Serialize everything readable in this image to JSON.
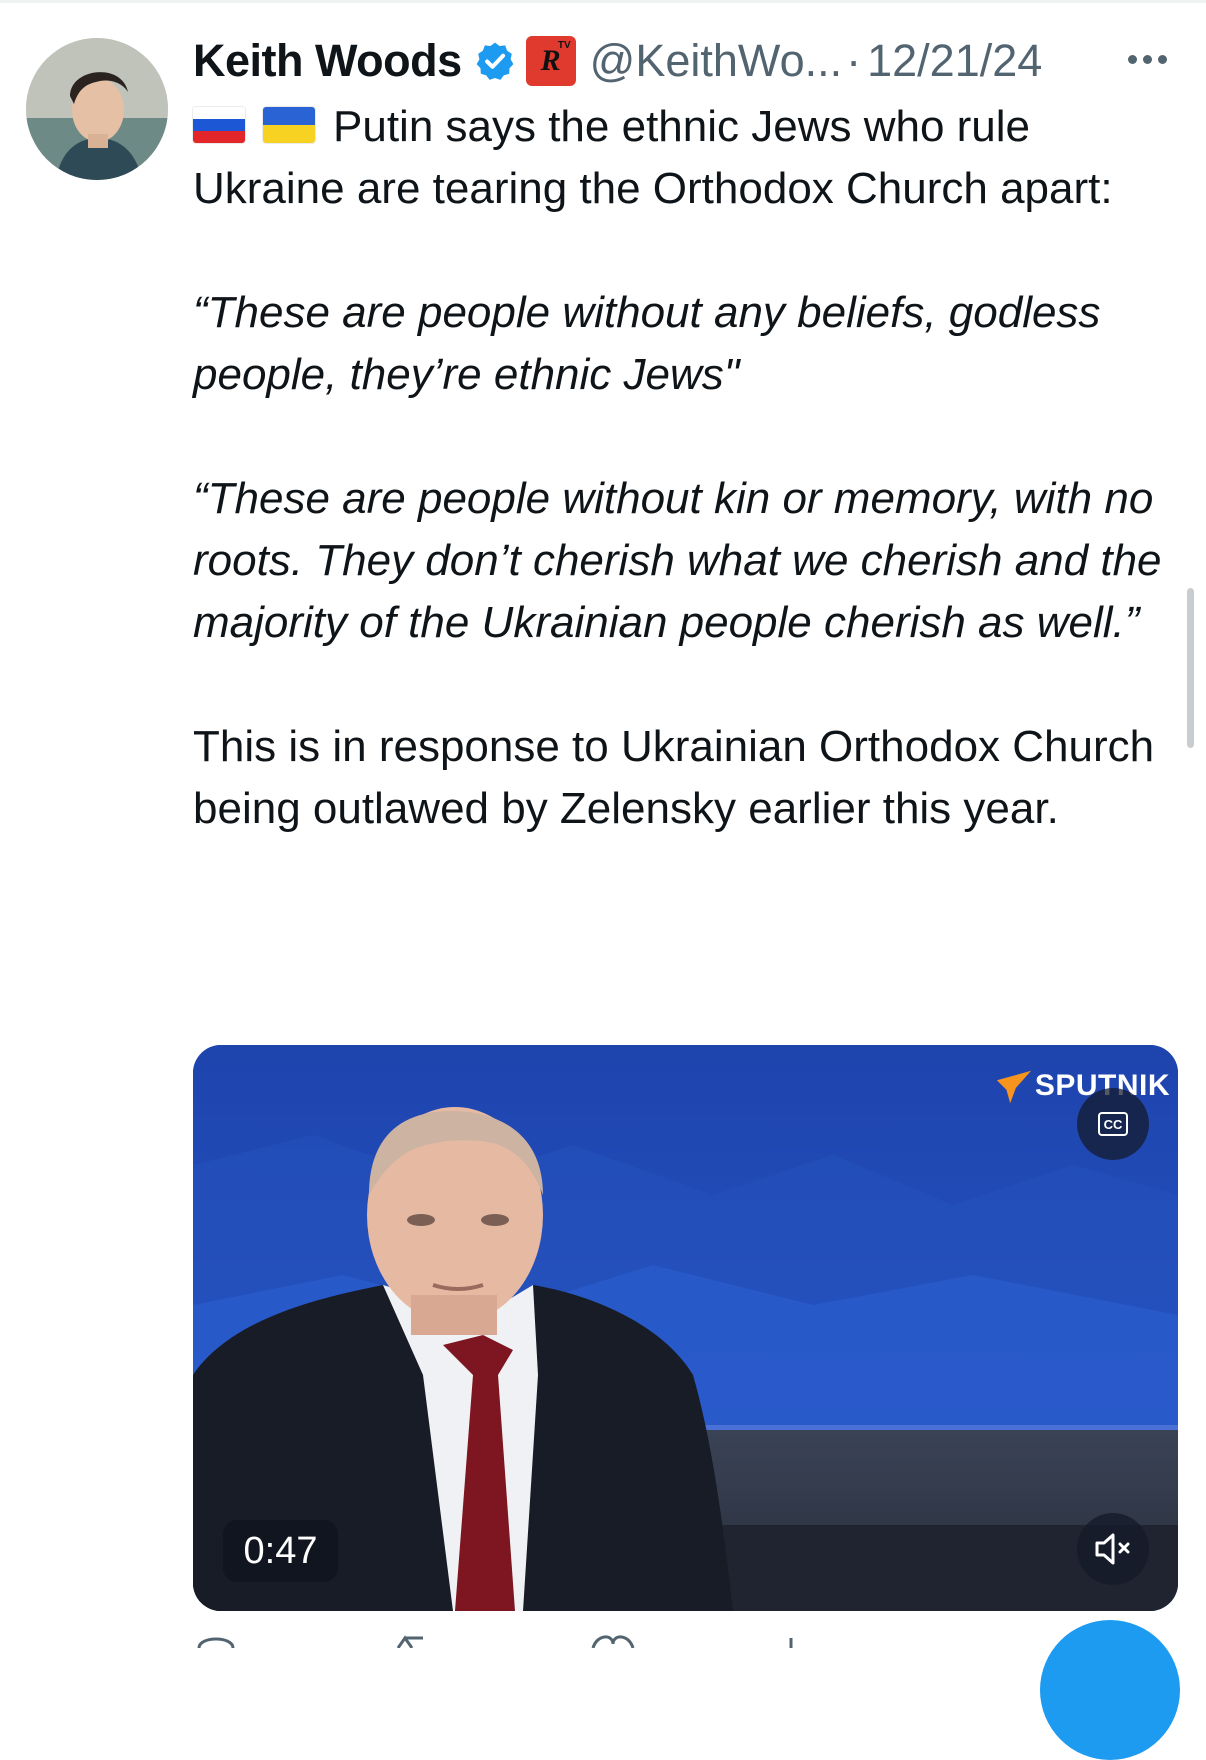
{
  "author": {
    "display_name": "Keith Woods",
    "handle": "@KeithWo...",
    "separator": "·",
    "date": "12/21/24",
    "verified": true,
    "badge_label": "R",
    "badge_sub": "TV"
  },
  "tweet": {
    "flags": [
      "flag-russia-icon",
      "flag-ukraine-icon"
    ],
    "line1": "Putin says the ethnic Jews who rule Ukraine are tearing the Orthodox Church apart:",
    "quote1": "“These are people without any beliefs, godless people, they’re ethnic Jews\"",
    "quote2": "“These are people without kin or memory, with no roots. They don’t cherish what we cherish and the majority of the Ukrainian people cherish as well.”",
    "closing": "This is in response to Ukrainian Orthodox Church being outlawed by Zelensky earlier this year."
  },
  "media": {
    "watermark": "SPUTNIK",
    "cc_label": "CC",
    "duration": "0:47"
  },
  "colors": {
    "text": "#0f1419",
    "secondary": "#536471",
    "verified": "#1d9bf0",
    "badge_bg": "#e03a2e",
    "media_bg": "#1f48b4"
  }
}
